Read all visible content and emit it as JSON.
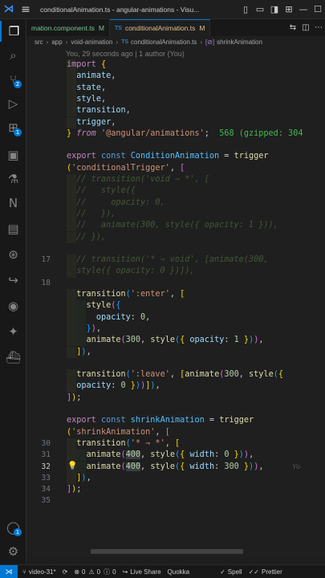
{
  "titlebar": {
    "title": "conditionalAnimation.ts - angular-animations - Visu..."
  },
  "tabs": [
    {
      "label": "mation.component.ts",
      "modified": "M",
      "active": false
    },
    {
      "label": "conditionalAnimation.ts",
      "modified": "M",
      "active": true
    }
  ],
  "breadcrumb": {
    "parts": [
      "src",
      "app",
      "void-animation"
    ],
    "file": "conditionalAnimation.ts",
    "symbol": "shrinkAnimation"
  },
  "editor": {
    "blame": "You, 29 seconds ago | 1 author (You)",
    "current_line": 32,
    "import_hint": "568 (gzipped: 304",
    "inline_blame": "Yo",
    "line_numbers": [
      "",
      "",
      "",
      "",
      "",
      "",
      "",
      "",
      "",
      "",
      "",
      "",
      "",
      "",
      "",
      "",
      "17",
      "",
      "18",
      "",
      "",
      "",
      "",
      "",
      "",
      "",
      "",
      "",
      "",
      "",
      "",
      "",
      "",
      "30",
      "31",
      "32",
      "33",
      "34",
      "35"
    ]
  },
  "statusbar": {
    "branch": "video-31*",
    "problems": "0",
    "warnings": "0",
    "infos": "0",
    "live_share": "Live Share",
    "quokka": "Quokka",
    "spell": "Spell",
    "prettier": "Prettier"
  },
  "activity_badges": {
    "source_control": "2",
    "extensions": "1",
    "accounts": "1"
  },
  "colors": {
    "accent": "#0078d4",
    "keyword": "#569cd6",
    "control": "#c586c0",
    "function": "#dcdcaa",
    "string": "#ce9178",
    "number": "#b5cea8",
    "property": "#9cdcfe"
  }
}
